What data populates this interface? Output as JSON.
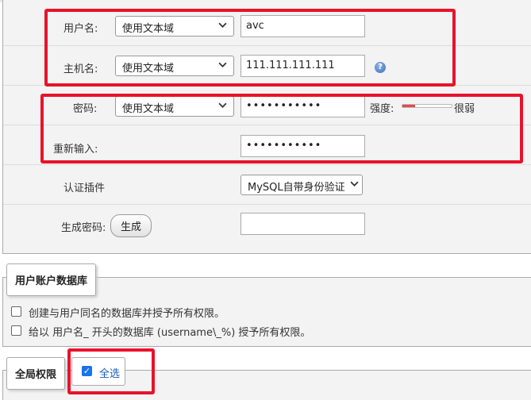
{
  "login": {
    "username_label": "用户名:",
    "username_mode": "使用文本域",
    "username_value": "avc",
    "host_label": "主机名:",
    "host_mode": "使用文本域",
    "host_value": "111.111.111.111",
    "password_label": "密码:",
    "password_mode": "使用文本域",
    "password_value": "•••••••••••",
    "strength_label": "强度:",
    "strength_text": "很弱",
    "strength_level": 0.25,
    "reenter_label": "重新输入:",
    "reenter_value": "•••••••••••",
    "auth_plugin_label": "认证插件",
    "auth_plugin_value": "MySQL自带身份验证",
    "generate_label": "生成密码:",
    "generate_button": "生成",
    "generated_value": ""
  },
  "database": {
    "legend": "用户账户数据库",
    "options": [
      "创建与用户同名的数据库并授予所有权限。",
      "给以 用户名_ 开头的数据库 (username\\_%) 授予所有权限。"
    ]
  },
  "global": {
    "legend": "全局权限",
    "select_all": "全选",
    "select_all_checked": true
  },
  "colors": {
    "highlight": "#e8132b",
    "checkbox_checked": "#1a73e8"
  }
}
